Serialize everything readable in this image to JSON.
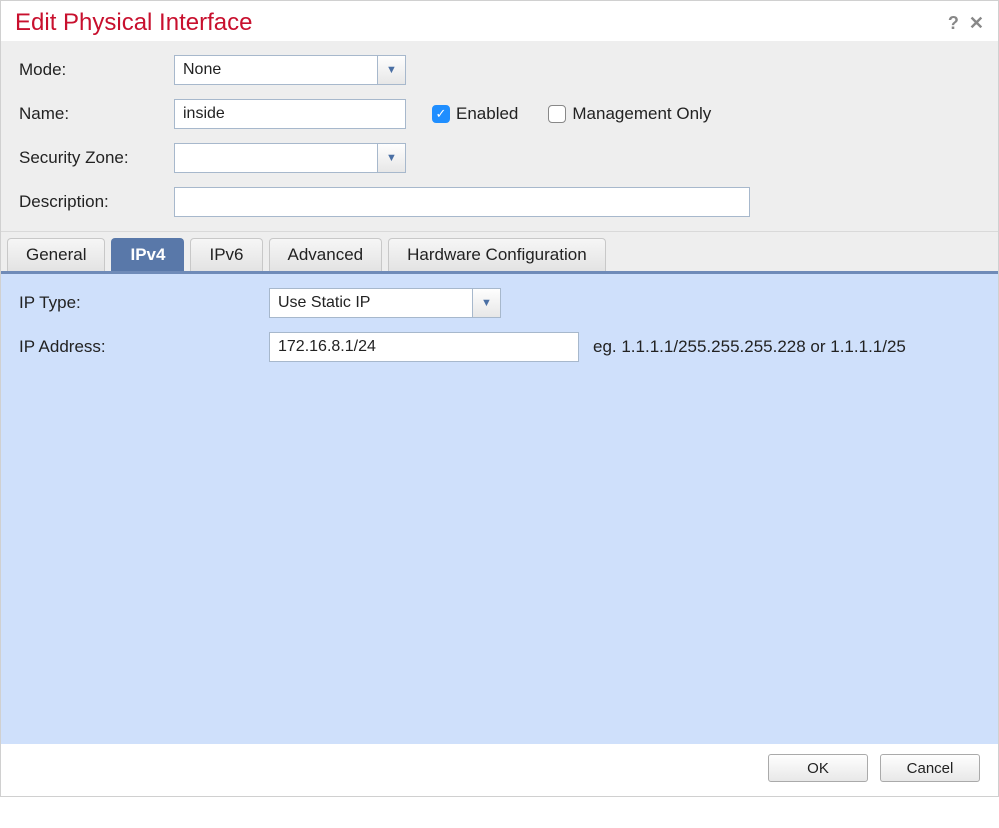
{
  "dialog": {
    "title": "Edit Physical Interface"
  },
  "form": {
    "mode_label": "Mode:",
    "mode_value": "None",
    "name_label": "Name:",
    "name_value": "inside",
    "enabled_label": "Enabled",
    "enabled_checked": true,
    "mgmt_only_label": "Management Only",
    "mgmt_only_checked": false,
    "security_zone_label": "Security Zone:",
    "security_zone_value": "",
    "description_label": "Description:",
    "description_value": ""
  },
  "tabs": {
    "items": [
      {
        "label": "General",
        "active": false
      },
      {
        "label": "IPv4",
        "active": true
      },
      {
        "label": "IPv6",
        "active": false
      },
      {
        "label": "Advanced",
        "active": false
      },
      {
        "label": "Hardware Configuration",
        "active": false
      }
    ]
  },
  "ipv4": {
    "ip_type_label": "IP Type:",
    "ip_type_value": "Use Static IP",
    "ip_address_label": "IP Address:",
    "ip_address_value": "172.16.8.1/24",
    "ip_address_hint": "eg. 1.1.1.1/255.255.255.228 or 1.1.1.1/25"
  },
  "footer": {
    "ok": "OK",
    "cancel": "Cancel"
  }
}
